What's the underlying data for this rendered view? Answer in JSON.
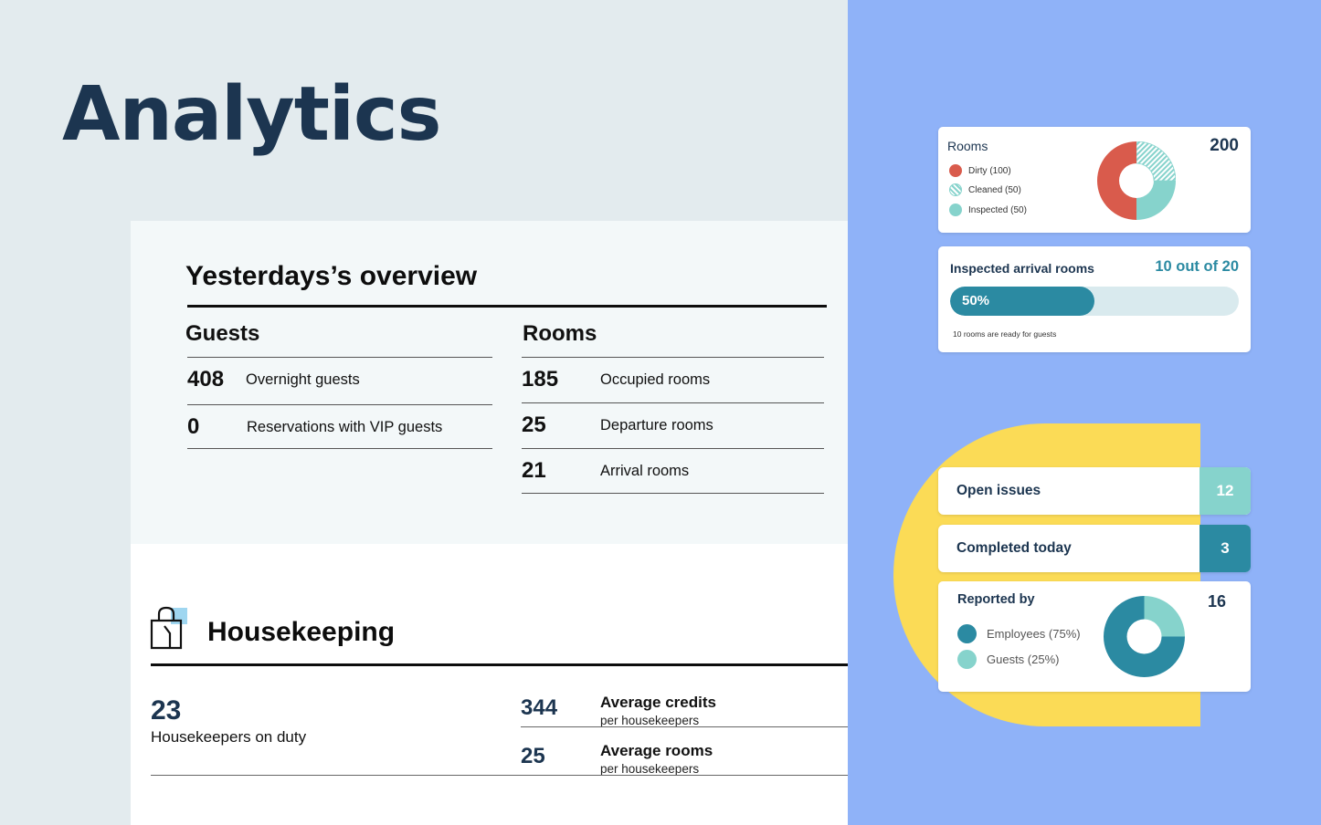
{
  "page": {
    "title": "Analytics"
  },
  "overview": {
    "title": "Yesterdays’s overview",
    "guests": {
      "heading": "Guests",
      "rows": [
        {
          "value": "408",
          "label": "Overnight guests"
        },
        {
          "value": "0",
          "label": "Reservations with VIP guests"
        }
      ]
    },
    "rooms": {
      "heading": "Rooms",
      "rows": [
        {
          "value": "185",
          "label": "Occupied rooms"
        },
        {
          "value": "25",
          "label": "Departure rooms"
        },
        {
          "value": "21",
          "label": "Arrival rooms"
        }
      ]
    }
  },
  "housekeeping": {
    "title": "Housekeeping",
    "icon": "shopping-bag-icon",
    "on_duty": {
      "value": "23",
      "label": "Housekeepers on duty"
    },
    "stats": [
      {
        "value": "344",
        "title": "Average credits",
        "sub": "per housekeepers"
      },
      {
        "value": "25",
        "title": "Average rooms",
        "sub": "per housekeepers"
      }
    ]
  },
  "rooms_card": {
    "title": "Rooms",
    "total": "200",
    "legend": [
      {
        "label": "Dirty (100)",
        "color": "#d95b4c",
        "value": 100,
        "pattern": "solid"
      },
      {
        "label": "Cleaned (50)",
        "color": "#86d3cc",
        "value": 50,
        "pattern": "hatched"
      },
      {
        "label": "Inspected (50)",
        "color": "#86d3cc",
        "value": 50,
        "pattern": "solid"
      }
    ]
  },
  "arrival_card": {
    "title": "Inspected arrival rooms",
    "count": "10 out of 20",
    "progress_label": "50%",
    "progress": 0.5,
    "note": "10 rooms are ready for guests"
  },
  "issues": {
    "open": {
      "label": "Open issues",
      "value": "12",
      "color": "#86d3cc"
    },
    "completed": {
      "label": "Completed today",
      "value": "3",
      "color": "#2b8aa2"
    }
  },
  "reported_card": {
    "title": "Reported by",
    "total": "16",
    "legend": [
      {
        "label": "Employees (75%)",
        "color": "#2b8aa2",
        "value": 75
      },
      {
        "label": "Guests (25%)",
        "color": "#86d3cc",
        "value": 25
      }
    ]
  },
  "colors": {
    "navy": "#1c3550",
    "teal": "#2b8aa2",
    "mint": "#86d3cc",
    "coral": "#d95b4c",
    "yellow": "#fbdb56",
    "periwinkle": "#8fb2f8"
  }
}
